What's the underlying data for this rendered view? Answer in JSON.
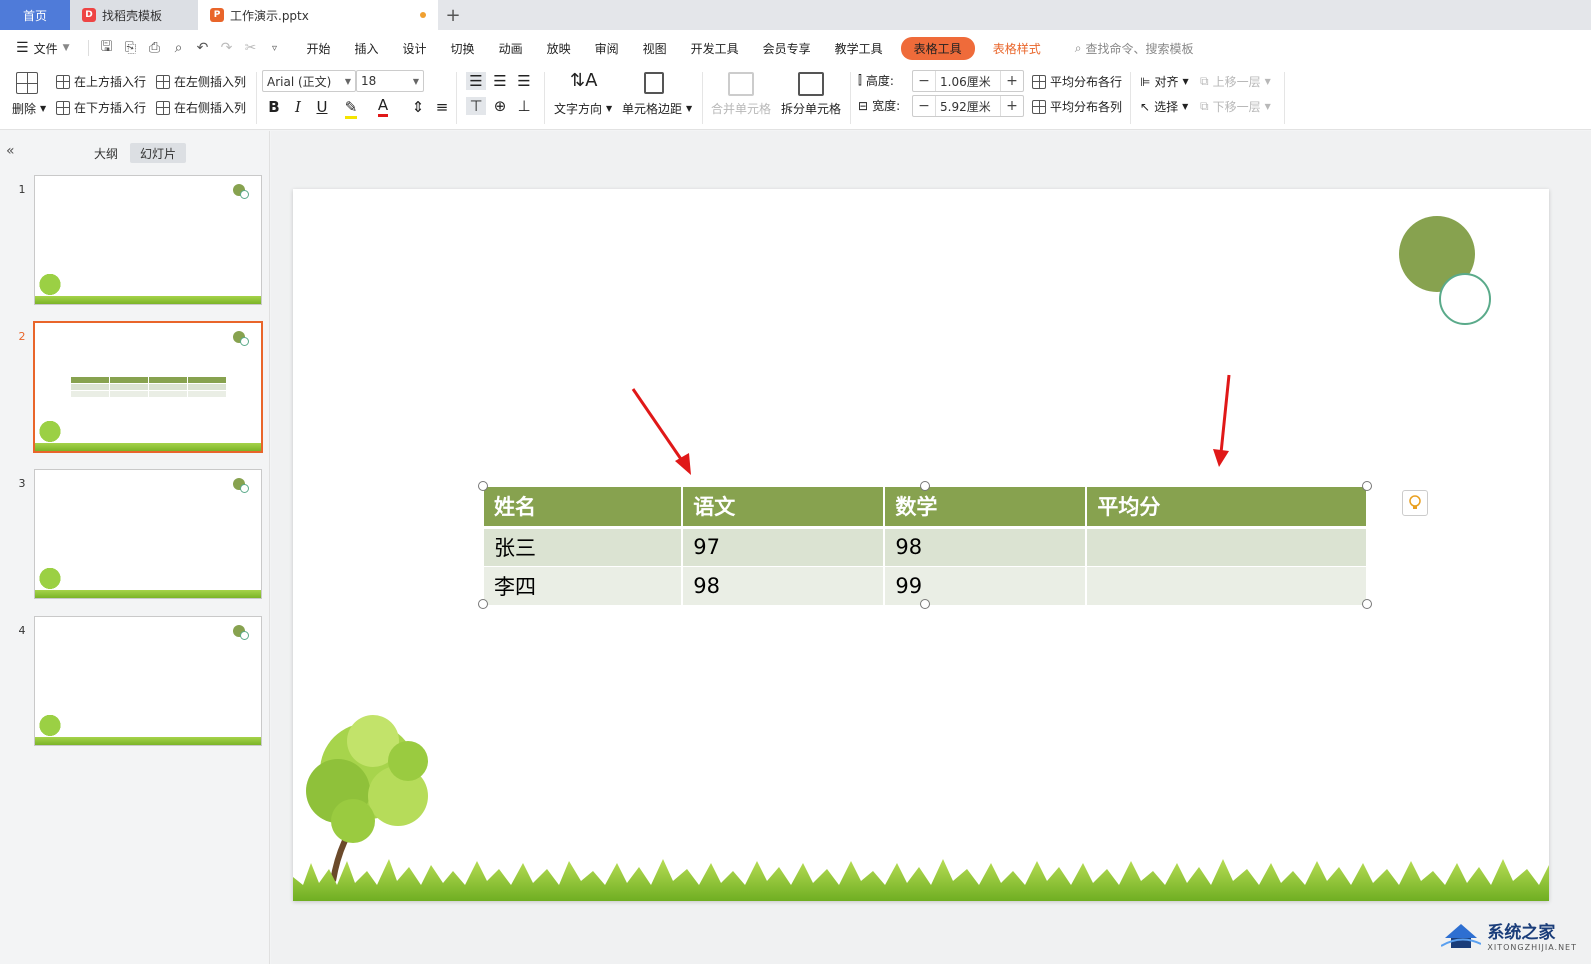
{
  "tabs": {
    "home": "首页",
    "template": "找稻壳模板",
    "document": "工作演示.pptx"
  },
  "menu": {
    "file": "文件",
    "items": [
      "开始",
      "插入",
      "设计",
      "切换",
      "动画",
      "放映",
      "审阅",
      "视图",
      "开发工具",
      "会员专享",
      "教学工具"
    ],
    "table_tools": "表格工具",
    "table_style": "表格样式",
    "search": "查找命令、搜索模板"
  },
  "ribbon": {
    "delete": "删除",
    "insert_above": "在上方插入行",
    "insert_below": "在下方插入行",
    "insert_left": "在左侧插入列",
    "insert_right": "在右侧插入列",
    "font_name": "Arial (正文)",
    "font_size": "18",
    "bold": "B",
    "italic": "I",
    "underline": "U",
    "font_color": "A",
    "text_direction": "文字方向",
    "cell_margin": "单元格边距",
    "merge_cells": "合并单元格",
    "split_cells": "拆分单元格",
    "height_label": "高度:",
    "height_value": "1.06厘米",
    "width_label": "宽度:",
    "width_value": "5.92厘米",
    "distribute_rows": "平均分布各行",
    "distribute_cols": "平均分布各列",
    "align": "对齐",
    "select": "选择",
    "bring_forward": "上移一层",
    "send_backward": "下移一层",
    "minus": "−",
    "plus": "+"
  },
  "left_panel": {
    "collapse": "«",
    "outline_tab": "大纲",
    "slides_tab": "幻灯片",
    "slide_numbers": [
      "1",
      "2",
      "3",
      "4"
    ],
    "selected_slide": "2"
  },
  "slide_table": {
    "headers": [
      "姓名",
      "语文",
      "数学",
      "平均分"
    ],
    "rows": [
      [
        "张三",
        "97",
        "98",
        ""
      ],
      [
        "李四",
        "98",
        "99",
        ""
      ]
    ]
  },
  "colors": {
    "accent": "#e9652a",
    "home_tab": "#4f7bd9",
    "table_header": "#87a24f",
    "row_odd": "#dbe3d2",
    "row_even": "#eaeee5",
    "arrow": "#e01818"
  },
  "watermark": {
    "title": "系统之家",
    "subtitle": "XITONGZHIJIA.NET"
  }
}
